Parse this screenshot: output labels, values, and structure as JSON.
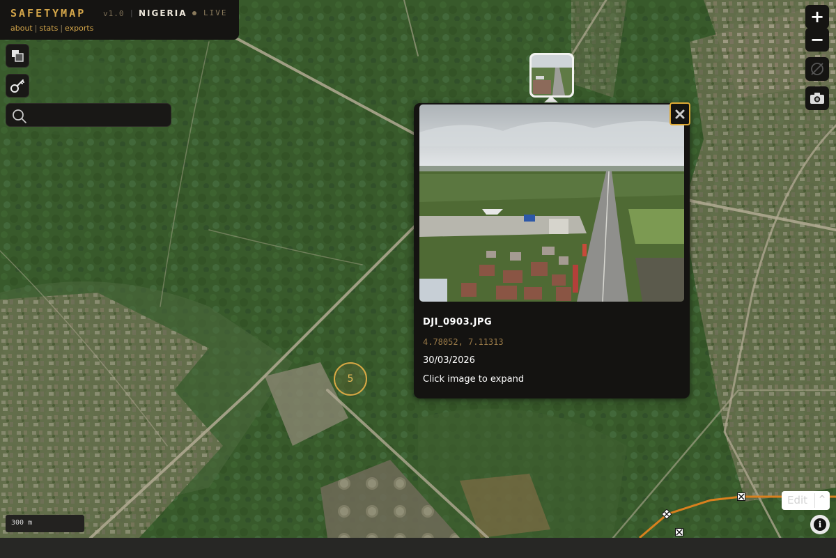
{
  "header": {
    "brand": "SAFETYMAP",
    "version": "v1.0",
    "separator": "|",
    "country": "NIGERIA",
    "status": "LIVE",
    "links": [
      "about",
      "stats",
      "exports"
    ]
  },
  "search": {
    "placeholder": "",
    "value": ""
  },
  "popup": {
    "filename": "DJI_0903.JPG",
    "coords": "4.78052, 7.11313",
    "date": "30/03/2026",
    "hint": "Click image to expand"
  },
  "cluster": {
    "count": "5"
  },
  "scale": {
    "label": "300 m"
  },
  "edit": {
    "label": "Edit",
    "caret": "^"
  },
  "controls": {
    "zoom_in": "+",
    "zoom_out": "−"
  },
  "colors": {
    "accent": "#d4a64a",
    "panel": "#151412",
    "route": "#d9801e"
  },
  "icons": [
    "layers-icon",
    "key-icon",
    "search-icon",
    "compass-off-icon",
    "camera-icon",
    "close-icon",
    "info-icon"
  ]
}
